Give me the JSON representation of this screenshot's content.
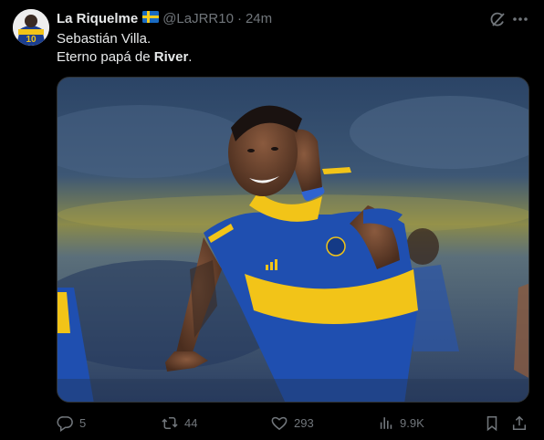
{
  "author": {
    "display_name": "La Riquelme",
    "flag_icon": "sweden-flag-icon",
    "handle": "@LaJRR10",
    "separator": "·",
    "time": "24m",
    "avatar_number": "10"
  },
  "tweet": {
    "line1": "Sebastián Villa.",
    "line2_prefix": "Eterno papá de ",
    "line2_bold": "River",
    "line2_suffix": "."
  },
  "media": {
    "type": "photo",
    "description_icon": "football-player-photo",
    "colors": {
      "jersey_blue": "#1f4fb0",
      "jersey_yellow": "#f2c418"
    }
  },
  "actions": {
    "reply_count": "5",
    "retweet_count": "44",
    "like_count": "293",
    "views_count": "9.9K"
  },
  "colors": {
    "background": "#000000",
    "text": "#e7e9ea",
    "muted": "#71767b"
  }
}
